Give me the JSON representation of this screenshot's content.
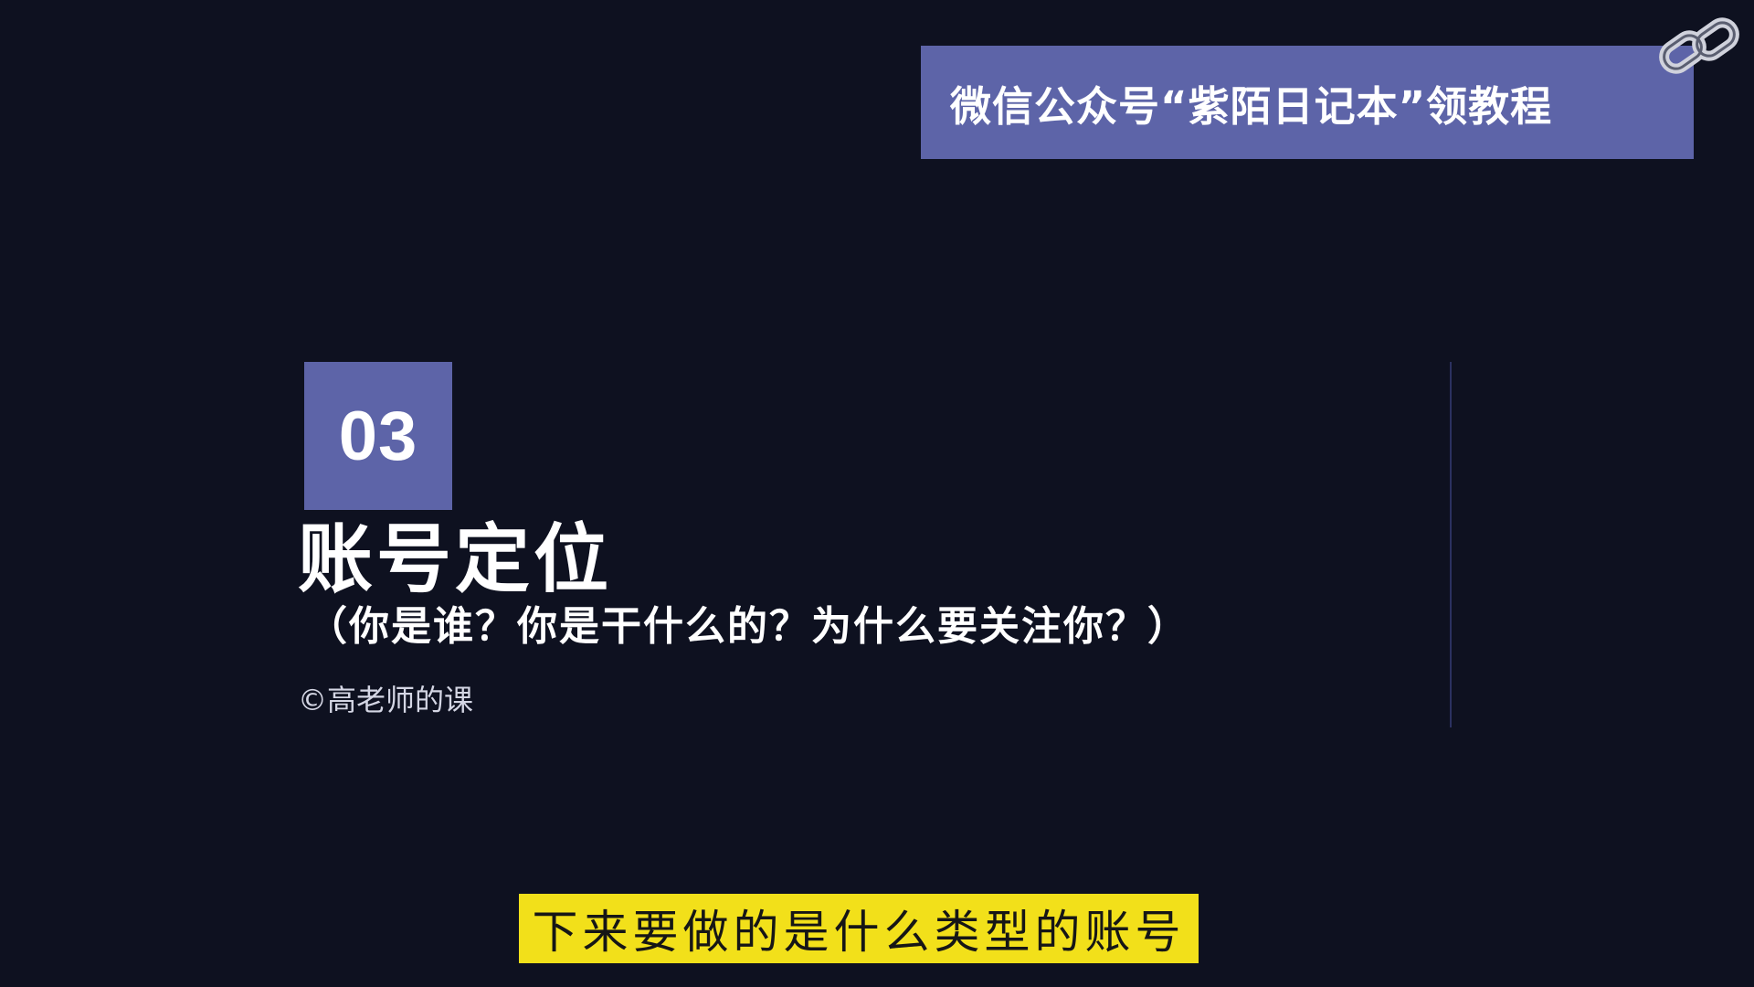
{
  "banner": {
    "text": "微信公众号“紫陌日记本”领教程"
  },
  "section": {
    "number": "03",
    "title": "账号定位",
    "subtitle": "（你是谁？你是干什么的？为什么要关注你？）",
    "copyright": "©高老师的课"
  },
  "caption": {
    "text": "下来要做的是什么类型的账号"
  },
  "icons": {
    "corner": "chain-link-icon"
  },
  "colors": {
    "background": "#0e1120",
    "accent": "#5d64a8",
    "caption_bg": "#f2e01a",
    "caption_text": "#161616",
    "text": "#ffffff"
  }
}
